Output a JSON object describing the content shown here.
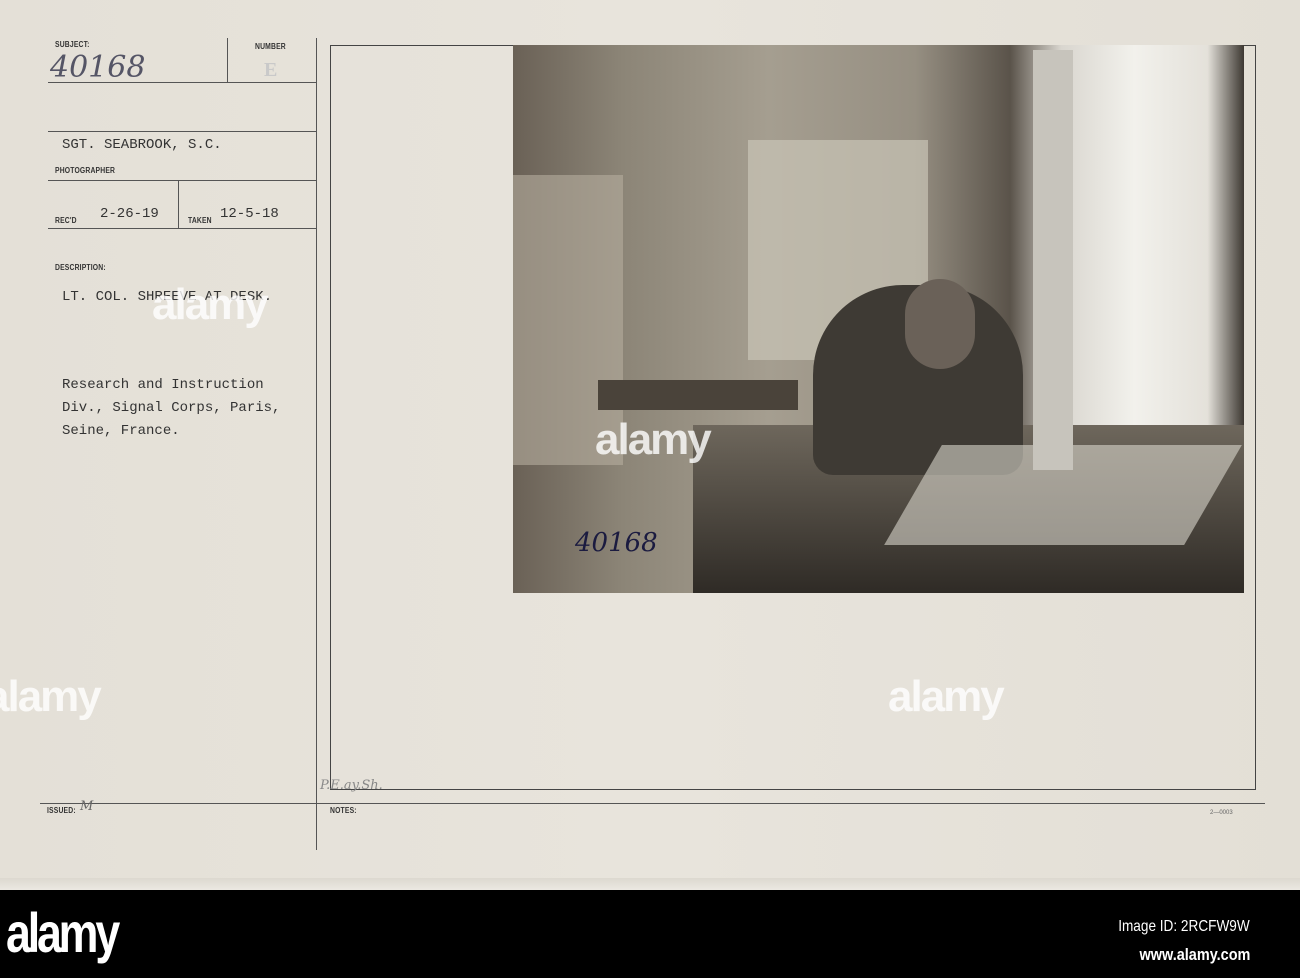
{
  "card": {
    "subject_label": "SUBJECT:",
    "subject_value": "40168",
    "number_label": "NUMBER",
    "number_value": "E",
    "photographer": "SGT. SEABROOK, S.C.",
    "photographer_label": "PHOTOGRAPHER",
    "recd_label": "REC'D",
    "recd_value": "2-26-19",
    "taken_label": "TAKEN",
    "taken_value": "12-5-18",
    "description_label": "DESCRIPTION:",
    "description_title": "LT. COL. SHREEVE AT DESK.",
    "description_lines": [
      "Research and Instruction",
      "Div., Signal Corps, Paris,",
      "Seine, France."
    ],
    "issued_label": "ISSUED:",
    "issued_value": "M",
    "notes_label": "NOTES:",
    "notes_value": "P.E.ay.Sh.",
    "form_code": "2—0003",
    "photo_number": "40168"
  },
  "watermark": "alamy",
  "footer": {
    "logo": "alamy",
    "image_id": "Image ID: 2RCFW9W",
    "url": "www.alamy.com"
  }
}
